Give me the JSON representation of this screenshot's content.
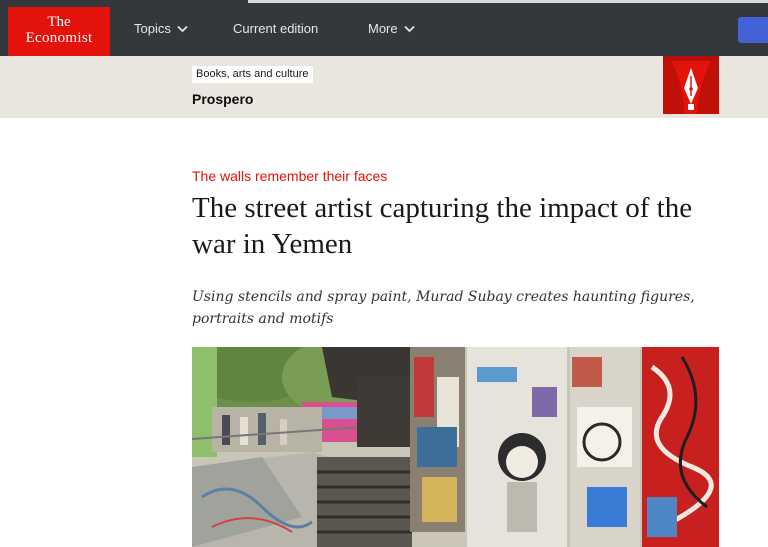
{
  "header": {
    "logo_line1": "The",
    "logo_line2": "Economist",
    "nav": {
      "topics": "Topics",
      "current_edition": "Current edition",
      "more": "More"
    }
  },
  "section": {
    "label": "Books, arts and culture",
    "title": "Prospero"
  },
  "article": {
    "rubric": "The walls remember their faces",
    "headline": "The street artist capturing the impact of the war in Yemen",
    "standfirst": "Using stencils and spray paint, Murad Subay creates haunting figures, portraits and motifs"
  },
  "icons": {
    "topics_chevron": "chevron-down-icon",
    "more_chevron": "chevron-down-icon",
    "section_logo": "prospero-pen-curtain-icon"
  },
  "colors": {
    "brand_red": "#e3120b",
    "nav_bg": "#34383d",
    "section_bg": "#e9e6df",
    "subscribe_blue": "#4563d8"
  }
}
